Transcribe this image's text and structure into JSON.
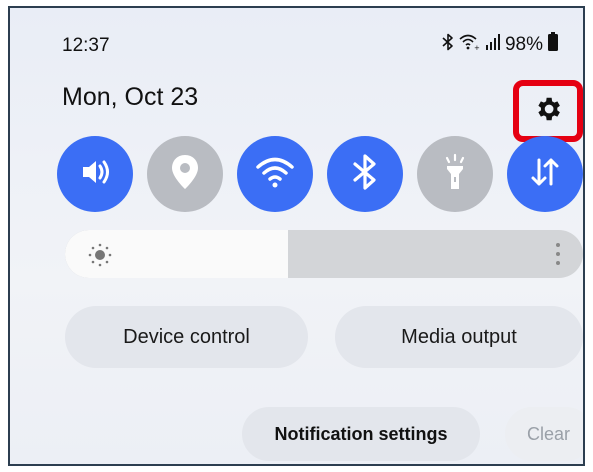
{
  "status_bar": {
    "time": "12:37",
    "battery": "98%",
    "icons": [
      "bluetooth-icon",
      "wifi-calling-icon",
      "signal-icon",
      "battery-icon"
    ]
  },
  "header": {
    "date": "Mon, Oct 23",
    "settings_icon": "gear-icon"
  },
  "quick_tiles": [
    {
      "icon": "sound-icon",
      "state": "on"
    },
    {
      "icon": "location-icon",
      "state": "off"
    },
    {
      "icon": "wifi-icon",
      "state": "on"
    },
    {
      "icon": "bluetooth-icon",
      "state": "on"
    },
    {
      "icon": "flashlight-icon",
      "state": "off"
    },
    {
      "icon": "mobile-data-icon",
      "state": "on"
    }
  ],
  "brightness": {
    "level": 0.43,
    "icon": "sun-icon",
    "more_icon": "more-vertical-icon"
  },
  "buttons": {
    "device_control": "Device control",
    "media_output": "Media output",
    "notification_settings": "Notification settings",
    "clear": "Clear"
  },
  "colors": {
    "accent": "#3b6ef5",
    "tile_off": "#b9bcc2",
    "highlight": "#e50012"
  }
}
